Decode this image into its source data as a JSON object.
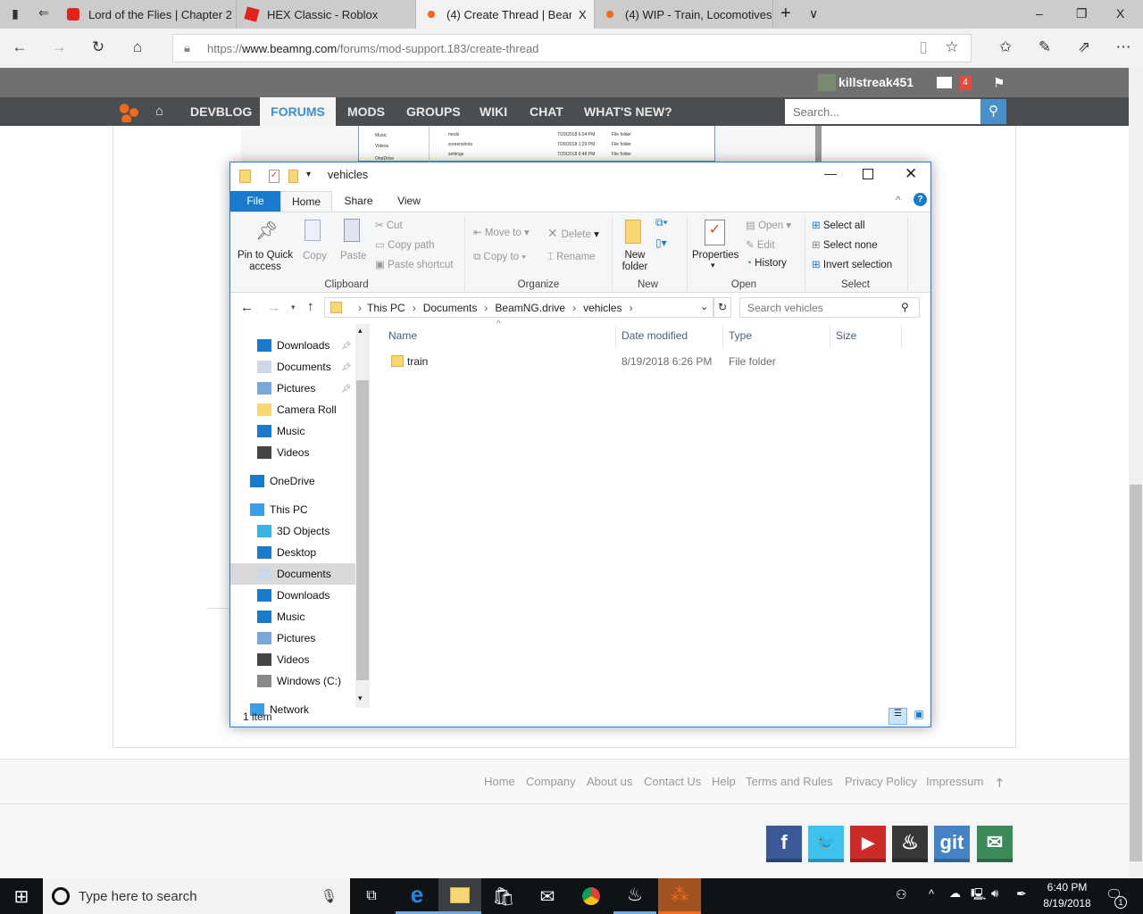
{
  "browser": {
    "tabs": [
      {
        "label": "Lord of the Flies | Chapter 2",
        "icon": "youtube-icon",
        "color": "#e62117"
      },
      {
        "label": "HEX Classic - Roblox",
        "icon": "roblox-icon",
        "color": "#e2231a"
      },
      {
        "label": "(4) Create Thread | Bear",
        "icon": "beamng-icon",
        "color": "#f26a1b",
        "active": true
      },
      {
        "label": "(4) WIP - Train, Locomotives",
        "icon": "beamng-icon",
        "color": "#f26a1b"
      }
    ],
    "close_tab": "X",
    "new_tab": "+",
    "tab_list": "∨",
    "url_prefix": "https://",
    "url_domain": "www.beamng.com",
    "url_path": "/forums/mod-support.183/create-thread",
    "window_controls": {
      "minimize": "–",
      "restore": "❐",
      "close": "X"
    }
  },
  "site": {
    "username": "killstreak451",
    "inbox_count": "4",
    "nav": [
      "DEVBLOG",
      "FORUMS",
      "MODS",
      "GROUPS",
      "WIKI",
      "CHAT",
      "WHAT'S NEW?"
    ],
    "active_nav": "FORUMS",
    "search_placeholder": "Search...",
    "footer_links": [
      "Home",
      "Company",
      "About us",
      "Contact Us",
      "Help",
      "Terms and Rules",
      "Privacy Policy",
      "Impressum"
    ],
    "social": [
      {
        "label": "f",
        "name": "facebook",
        "color": "#3b5998"
      },
      {
        "label": "🐦",
        "name": "twitter",
        "color": "#3ec2ef"
      },
      {
        "label": "▶",
        "name": "youtube",
        "color": "#cc2a27"
      },
      {
        "label": "♨",
        "name": "steam",
        "color": "#383838"
      },
      {
        "label": "git",
        "name": "github",
        "color": "#4382c4"
      },
      {
        "label": "✉",
        "name": "email",
        "color": "#3b8a58"
      }
    ],
    "accent": "#3d8fd1"
  },
  "background_explorer": {
    "nav": [
      "Music",
      "Videos",
      "OneDrive"
    ],
    "rows": [
      {
        "name": "mods",
        "date": "7/29/2018 6:04 PM",
        "type": "File folder"
      },
      {
        "name": "screenshots",
        "date": "7/26/2018 1:29 PM",
        "type": "File folder"
      },
      {
        "name": "settings",
        "date": "7/29/2018 6:48 PM",
        "type": "File folder"
      }
    ]
  },
  "explorer": {
    "title": "vehicles",
    "ribbon_tabs": [
      "File",
      "Home",
      "Share",
      "View"
    ],
    "clipboard": {
      "pin": "Pin to Quick access",
      "copy": "Copy",
      "paste": "Paste",
      "cut": "Cut",
      "copy_path": "Copy path",
      "paste_shortcut": "Paste shortcut",
      "group": "Clipboard"
    },
    "organize": {
      "move_to": "Move to",
      "copy_to": "Copy to",
      "delete": "Delete",
      "rename": "Rename",
      "group": "Organize"
    },
    "new": {
      "new_folder": "New folder",
      "group": "New"
    },
    "open": {
      "properties": "Properties",
      "open": "Open",
      "edit": "Edit",
      "history": "History",
      "group": "Open"
    },
    "select": {
      "select_all": "Select all",
      "select_none": "Select none",
      "invert": "Invert selection",
      "group": "Select"
    },
    "breadcrumb": [
      "This PC",
      "Documents",
      "BeamNG.drive",
      "vehicles"
    ],
    "search_placeholder": "Search vehicles",
    "nav_pane": [
      {
        "label": "Downloads",
        "icon": "download-icon",
        "pinned": true
      },
      {
        "label": "Documents",
        "icon": "documents-icon",
        "pinned": true
      },
      {
        "label": "Pictures",
        "icon": "pictures-icon",
        "pinned": true
      },
      {
        "label": "Camera Roll",
        "icon": "folder-icon"
      },
      {
        "label": "Music",
        "icon": "music-icon"
      },
      {
        "label": "Videos",
        "icon": "videos-icon"
      },
      {
        "label": "OneDrive",
        "icon": "onedrive-icon"
      },
      {
        "label": "This PC",
        "icon": "pc-icon"
      },
      {
        "label": "3D Objects",
        "icon": "3d-objects-icon"
      },
      {
        "label": "Desktop",
        "icon": "desktop-icon"
      },
      {
        "label": "Documents",
        "icon": "documents-icon",
        "selected": true
      },
      {
        "label": "Downloads",
        "icon": "download-icon"
      },
      {
        "label": "Music",
        "icon": "music-icon"
      },
      {
        "label": "Pictures",
        "icon": "pictures-icon"
      },
      {
        "label": "Videos",
        "icon": "videos-icon"
      },
      {
        "label": "Windows (C:)",
        "icon": "drive-icon"
      },
      {
        "label": "Network",
        "icon": "network-icon"
      }
    ],
    "columns": [
      "Name",
      "Date modified",
      "Type",
      "Size"
    ],
    "files": [
      {
        "name": "train",
        "date": "8/19/2018 6:26 PM",
        "type": "File folder",
        "size": ""
      }
    ],
    "status": "1 item"
  },
  "taskbar": {
    "search_placeholder": "Type here to search",
    "time": "6:40 PM",
    "date": "8/19/2018",
    "notifications": "1"
  }
}
